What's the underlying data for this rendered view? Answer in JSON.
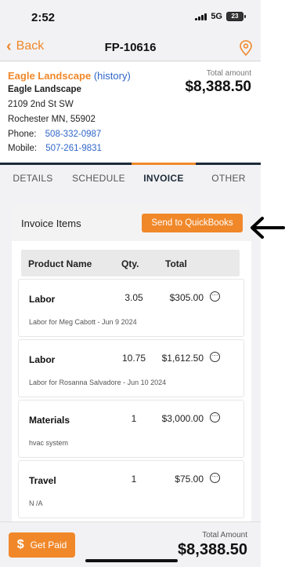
{
  "status_bar": {
    "time": "2:52",
    "network": "5G",
    "battery": "23"
  },
  "nav": {
    "back_label": "Back",
    "title": "FP-10616"
  },
  "customer": {
    "name": "Eagle Landscape",
    "history_link": "(history)",
    "company": "Eagle Landscape",
    "address_line1": "2109 2nd St SW",
    "address_line2": "Rochester MN,  55902",
    "phone_label": "Phone:",
    "phone": "508-332-0987",
    "mobile_label": "Mobile:",
    "mobile": "507-261-9831",
    "total_label": "Total amount",
    "total_amount": "$8,388.50"
  },
  "tabs": [
    {
      "label": "DETAILS",
      "active": false
    },
    {
      "label": "SCHEDULE",
      "active": false
    },
    {
      "label": "INVOICE",
      "active": true
    },
    {
      "label": "OTHER",
      "active": false
    }
  ],
  "invoice": {
    "title": "Invoice Items",
    "send_button": "Send to QuickBooks",
    "columns": {
      "product": "Product Name",
      "qty": "Qty.",
      "total": "Total"
    },
    "items": [
      {
        "name": "Labor",
        "qty": "3.05",
        "total": "$305.00",
        "description": "Labor for Meg Cabott - Jun 9 2024"
      },
      {
        "name": "Labor",
        "qty": "10.75",
        "total": "$1,612.50",
        "description": "Labor for Rosanna Salvadore - Jun 10 2024"
      },
      {
        "name": "Materials",
        "qty": "1",
        "total": "$3,000.00",
        "description": "hvac system"
      },
      {
        "name": "Travel",
        "qty": "1",
        "total": "$75.00",
        "description": "N /A"
      }
    ]
  },
  "bottom_bar": {
    "get_paid_label": "Get Paid",
    "total_label": "Total Amount",
    "total_amount": "$8,388.50"
  },
  "colors": {
    "accent": "#f0882a",
    "link": "#2f66c9",
    "navy": "#1d2b3a"
  }
}
